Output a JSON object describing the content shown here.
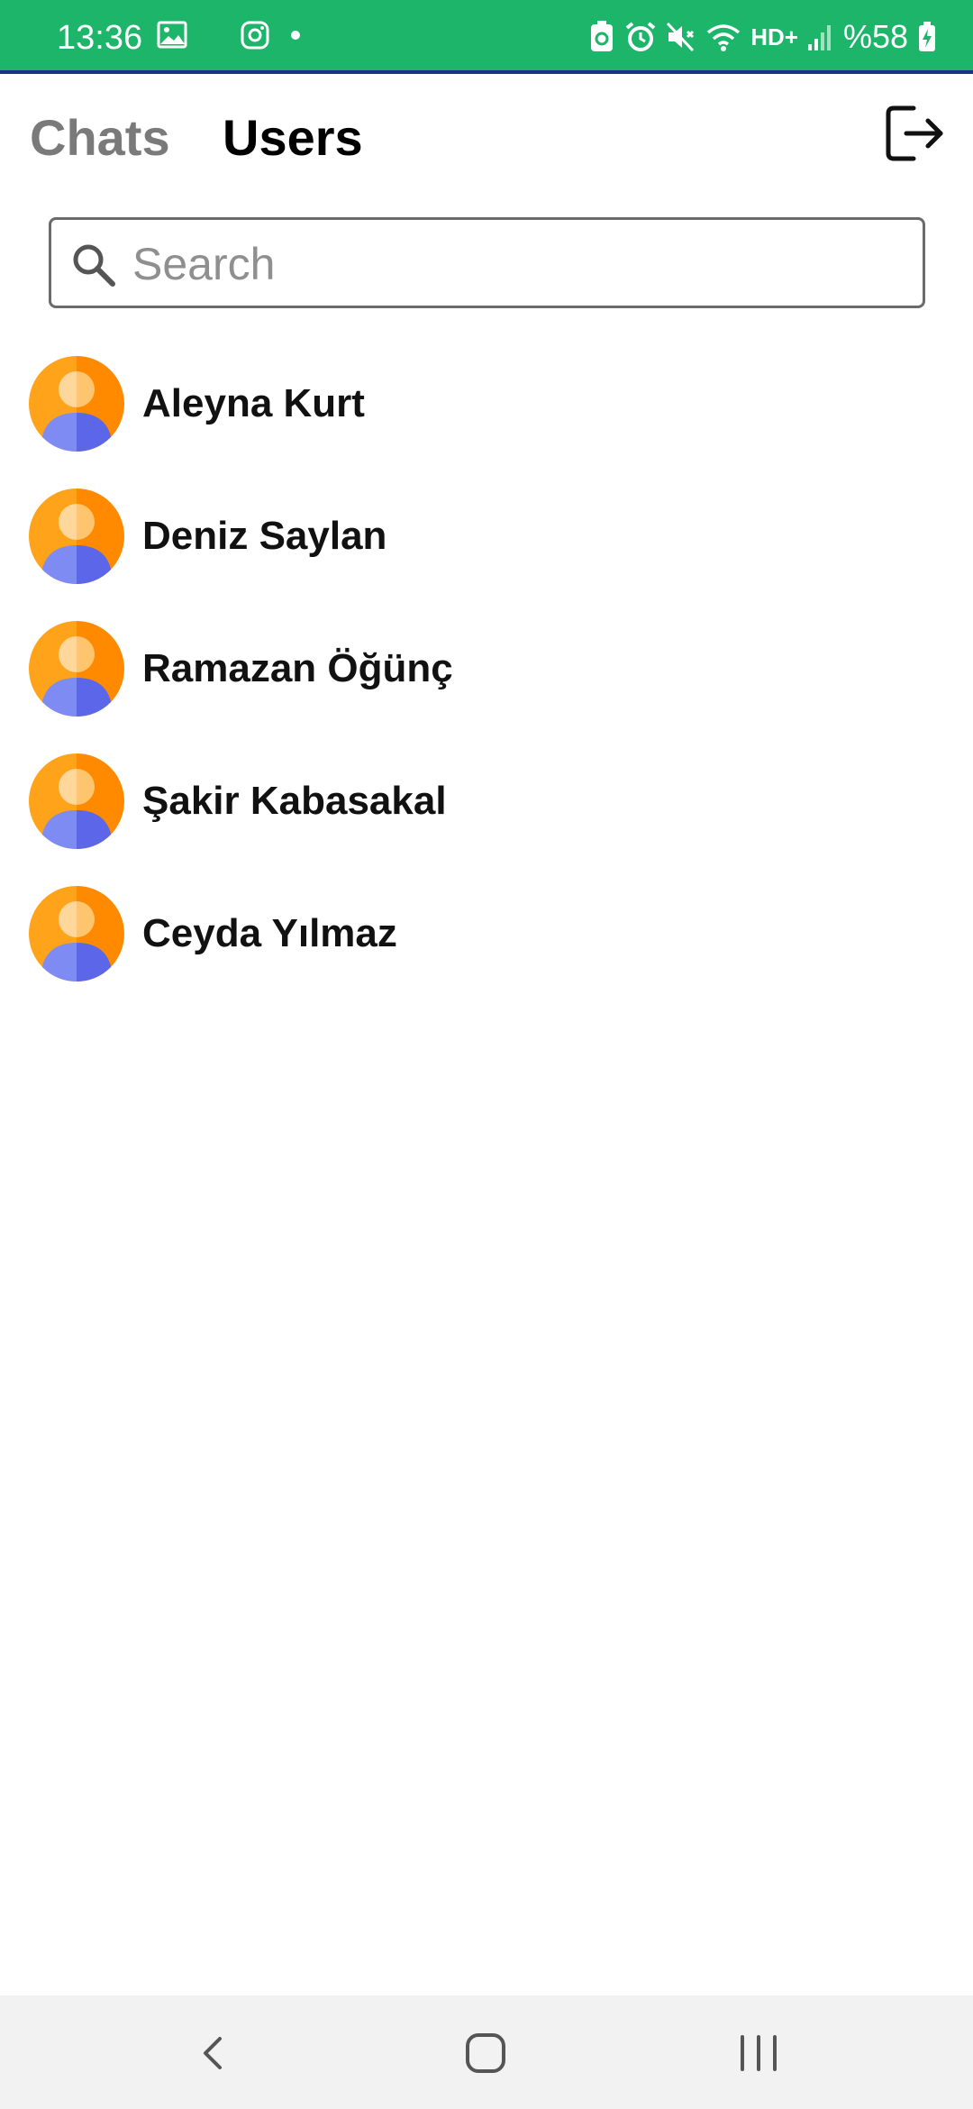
{
  "status_bar": {
    "time": "13:36",
    "battery": "%58",
    "network": "HD+",
    "background_color": "#1db569"
  },
  "header": {
    "tab_chats": "Chats",
    "tab_users": "Users",
    "active_tab": "Users"
  },
  "search": {
    "placeholder": "Search",
    "value": ""
  },
  "users": [
    {
      "name": "Aleyna Kurt",
      "avatar_icon": "user-avatar-icon"
    },
    {
      "name": "Deniz Saylan",
      "avatar_icon": "user-avatar-icon"
    },
    {
      "name": "Ramazan Öğünç",
      "avatar_icon": "user-avatar-icon"
    },
    {
      "name": "Şakir Kabasakal",
      "avatar_icon": "user-avatar-icon"
    },
    {
      "name": "Ceyda Yılmaz",
      "avatar_icon": "user-avatar-icon"
    }
  ],
  "colors": {
    "avatar_orange": "#ffa31a",
    "avatar_blue": "#6f7cf0",
    "active_tab": "#000000",
    "inactive_tab": "#7a7a7a"
  }
}
